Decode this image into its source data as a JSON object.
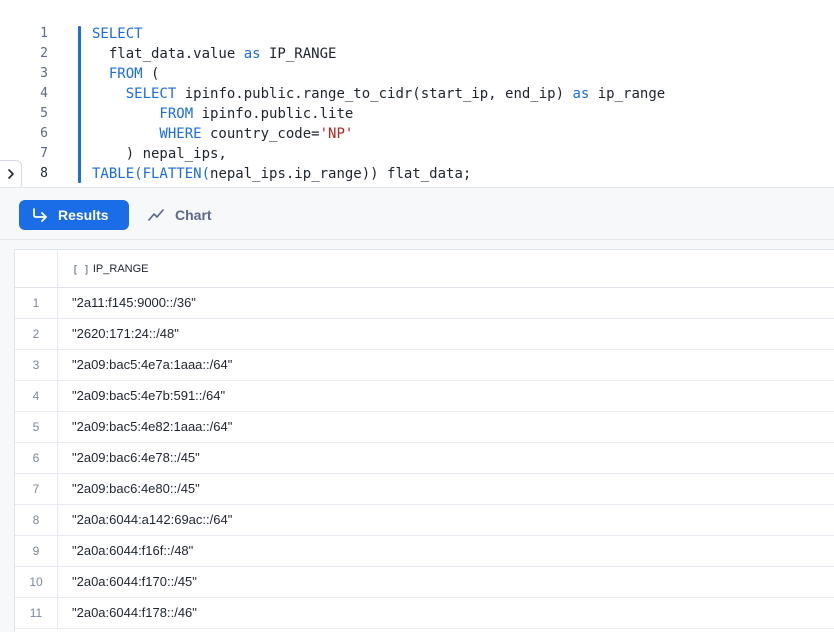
{
  "editor": {
    "line_numbers": [
      "1",
      "2",
      "3",
      "4",
      "5",
      "6",
      "7",
      "8"
    ],
    "lines": [
      [
        {
          "t": "SELECT",
          "c": "kw"
        }
      ],
      [
        {
          "t": "  flat_data.value ",
          "c": "id"
        },
        {
          "t": "as",
          "c": "kw"
        },
        {
          "t": " IP_RANGE",
          "c": "id"
        }
      ],
      [
        {
          "t": "  FROM",
          "c": "kw"
        },
        {
          "t": " (",
          "c": "id"
        }
      ],
      [
        {
          "t": "    SELECT",
          "c": "kw"
        },
        {
          "t": " ipinfo.public.range_to_cidr(start_ip, end_ip) ",
          "c": "id"
        },
        {
          "t": "as",
          "c": "kw"
        },
        {
          "t": " ip_range",
          "c": "id"
        }
      ],
      [
        {
          "t": "        FROM",
          "c": "kw"
        },
        {
          "t": " ipinfo.public.lite",
          "c": "id"
        }
      ],
      [
        {
          "t": "        WHERE",
          "c": "kw"
        },
        {
          "t": " country_code=",
          "c": "id"
        },
        {
          "t": "'NP'",
          "c": "str"
        }
      ],
      [
        {
          "t": "    ) nepal_ips,",
          "c": "id"
        }
      ],
      [
        {
          "t": "TABLE(FLATTEN(",
          "c": "kw"
        },
        {
          "t": "nepal_ips.ip_range)) flat_data;",
          "c": "id"
        }
      ]
    ],
    "active_line_index": 7
  },
  "tabs": {
    "results_label": "Results",
    "chart_label": "Chart",
    "active": "results"
  },
  "grid": {
    "column_type_icon": "[ ]",
    "column_name": "IP_RANGE",
    "rows": [
      {
        "index": "1",
        "value": "\"2a11:f145:9000::/36\""
      },
      {
        "index": "2",
        "value": "\"2620:171:24::/48\""
      },
      {
        "index": "3",
        "value": "\"2a09:bac5:4e7a:1aaa::/64\""
      },
      {
        "index": "4",
        "value": "\"2a09:bac5:4e7b:591::/64\""
      },
      {
        "index": "5",
        "value": "\"2a09:bac5:4e82:1aaa::/64\""
      },
      {
        "index": "6",
        "value": "\"2a09:bac6:4e78::/45\""
      },
      {
        "index": "7",
        "value": "\"2a09:bac6:4e80::/45\""
      },
      {
        "index": "8",
        "value": "\"2a0a:6044:a142:69ac::/64\""
      },
      {
        "index": "9",
        "value": "\"2a0a:6044:f16f::/48\""
      },
      {
        "index": "10",
        "value": "\"2a0a:6044:f170::/45\""
      },
      {
        "index": "11",
        "value": "\"2a0a:6044:f178::/46\""
      }
    ]
  },
  "colors": {
    "accent": "#1a6ce7",
    "keyword": "#1a6ce7",
    "string": "#b3261e",
    "text": "#1e252f",
    "muted": "#5d6a85"
  },
  "icons": {
    "panel_toggle": "chevron-right-icon",
    "results_tab": "return-arrow-icon",
    "chart_tab": "trend-line-icon"
  }
}
